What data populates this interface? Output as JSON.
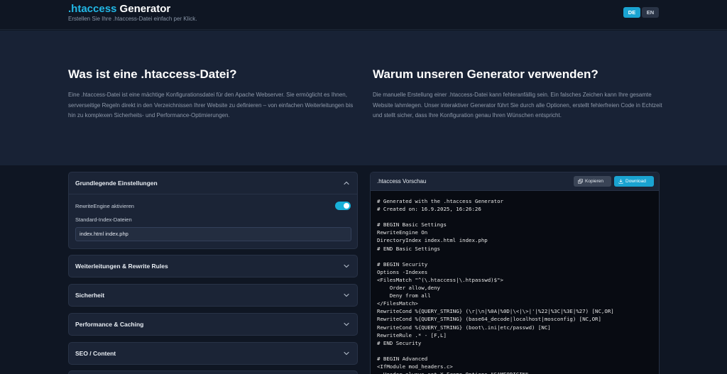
{
  "header": {
    "title_accent": ".htaccess",
    "title_rest": " Generator",
    "subtitle": "Erstellen Sie Ihre .htaccess-Datei einfach per Klick.",
    "languages": [
      "DE",
      "EN"
    ],
    "active_language": "DE"
  },
  "intro": {
    "left": {
      "heading": "Was ist eine .htaccess-Datei?",
      "text": "Eine .htaccess-Datei ist eine mächtige Konfigurationsdatei für den Apache Webserver. Sie ermöglicht es Ihnen, serverseitige Regeln direkt in den Verzeichnissen Ihrer Website zu definieren – von einfachen Weiterleitungen bis hin zu komplexen Sicherheits- und Performance-Optimierungen."
    },
    "right": {
      "heading": "Warum unseren Generator verwenden?",
      "text": "Die manuelle Erstellung einer .htaccess-Datei kann fehleranfällig sein. Ein falsches Zeichen kann Ihre gesamte Website lahmlegen. Unser interaktiver Generator führt Sie durch alle Optionen, erstellt fehlerfreien Code in Echtzeit und stellt sicher, dass Ihre Konfiguration genau Ihren Wünschen entspricht."
    }
  },
  "settings": {
    "basic": {
      "title": "Grundlegende Einstellungen",
      "rewrite_label": "RewriteEngine aktivieren",
      "rewrite_enabled": true,
      "index_label": "Standard-Index-Dateien",
      "index_value": "index.html index.php"
    },
    "sections": [
      "Weiterleitungen & Rewrite Rules",
      "Sicherheit",
      "Performance & Caching",
      "SEO / Content"
    ]
  },
  "preview": {
    "title": ".htaccess Vorschau",
    "copy_label": "Kopieren",
    "download_label": "Download",
    "lines": [
      "# Generated with the .htaccess Generator",
      "# Created on: 16.9.2025, 16:26:26",
      "",
      "# BEGIN Basic Settings",
      "RewriteEngine On",
      "DirectoryIndex index.html index.php",
      "# END Basic Settings",
      "",
      "# BEGIN Security",
      "Options -Indexes",
      "<FilesMatch \"^(\\.htaccess|\\.htpasswd)$\">",
      "    Order allow,deny",
      "    Deny from all",
      "</FilesMatch>",
      "RewriteCond %{QUERY_STRING} (\\r|\\n|%0A|%0D|\\<|\\>|'|%22|%3C|%3E|%27) [NC,OR]",
      "RewriteCond %{QUERY_STRING} (base64_decode|localhost|mosconfig) [NC,OR]",
      "RewriteCond %{QUERY_STRING} (boot\\.ini|etc/passwd) [NC]",
      "RewriteRule .* - [F,L]",
      "# END Security",
      "",
      "# BEGIN Advanced",
      "<IfModule mod_headers.c>",
      "  Header always set X-Frame-Options \"SAMEORIGIN\""
    ]
  }
}
